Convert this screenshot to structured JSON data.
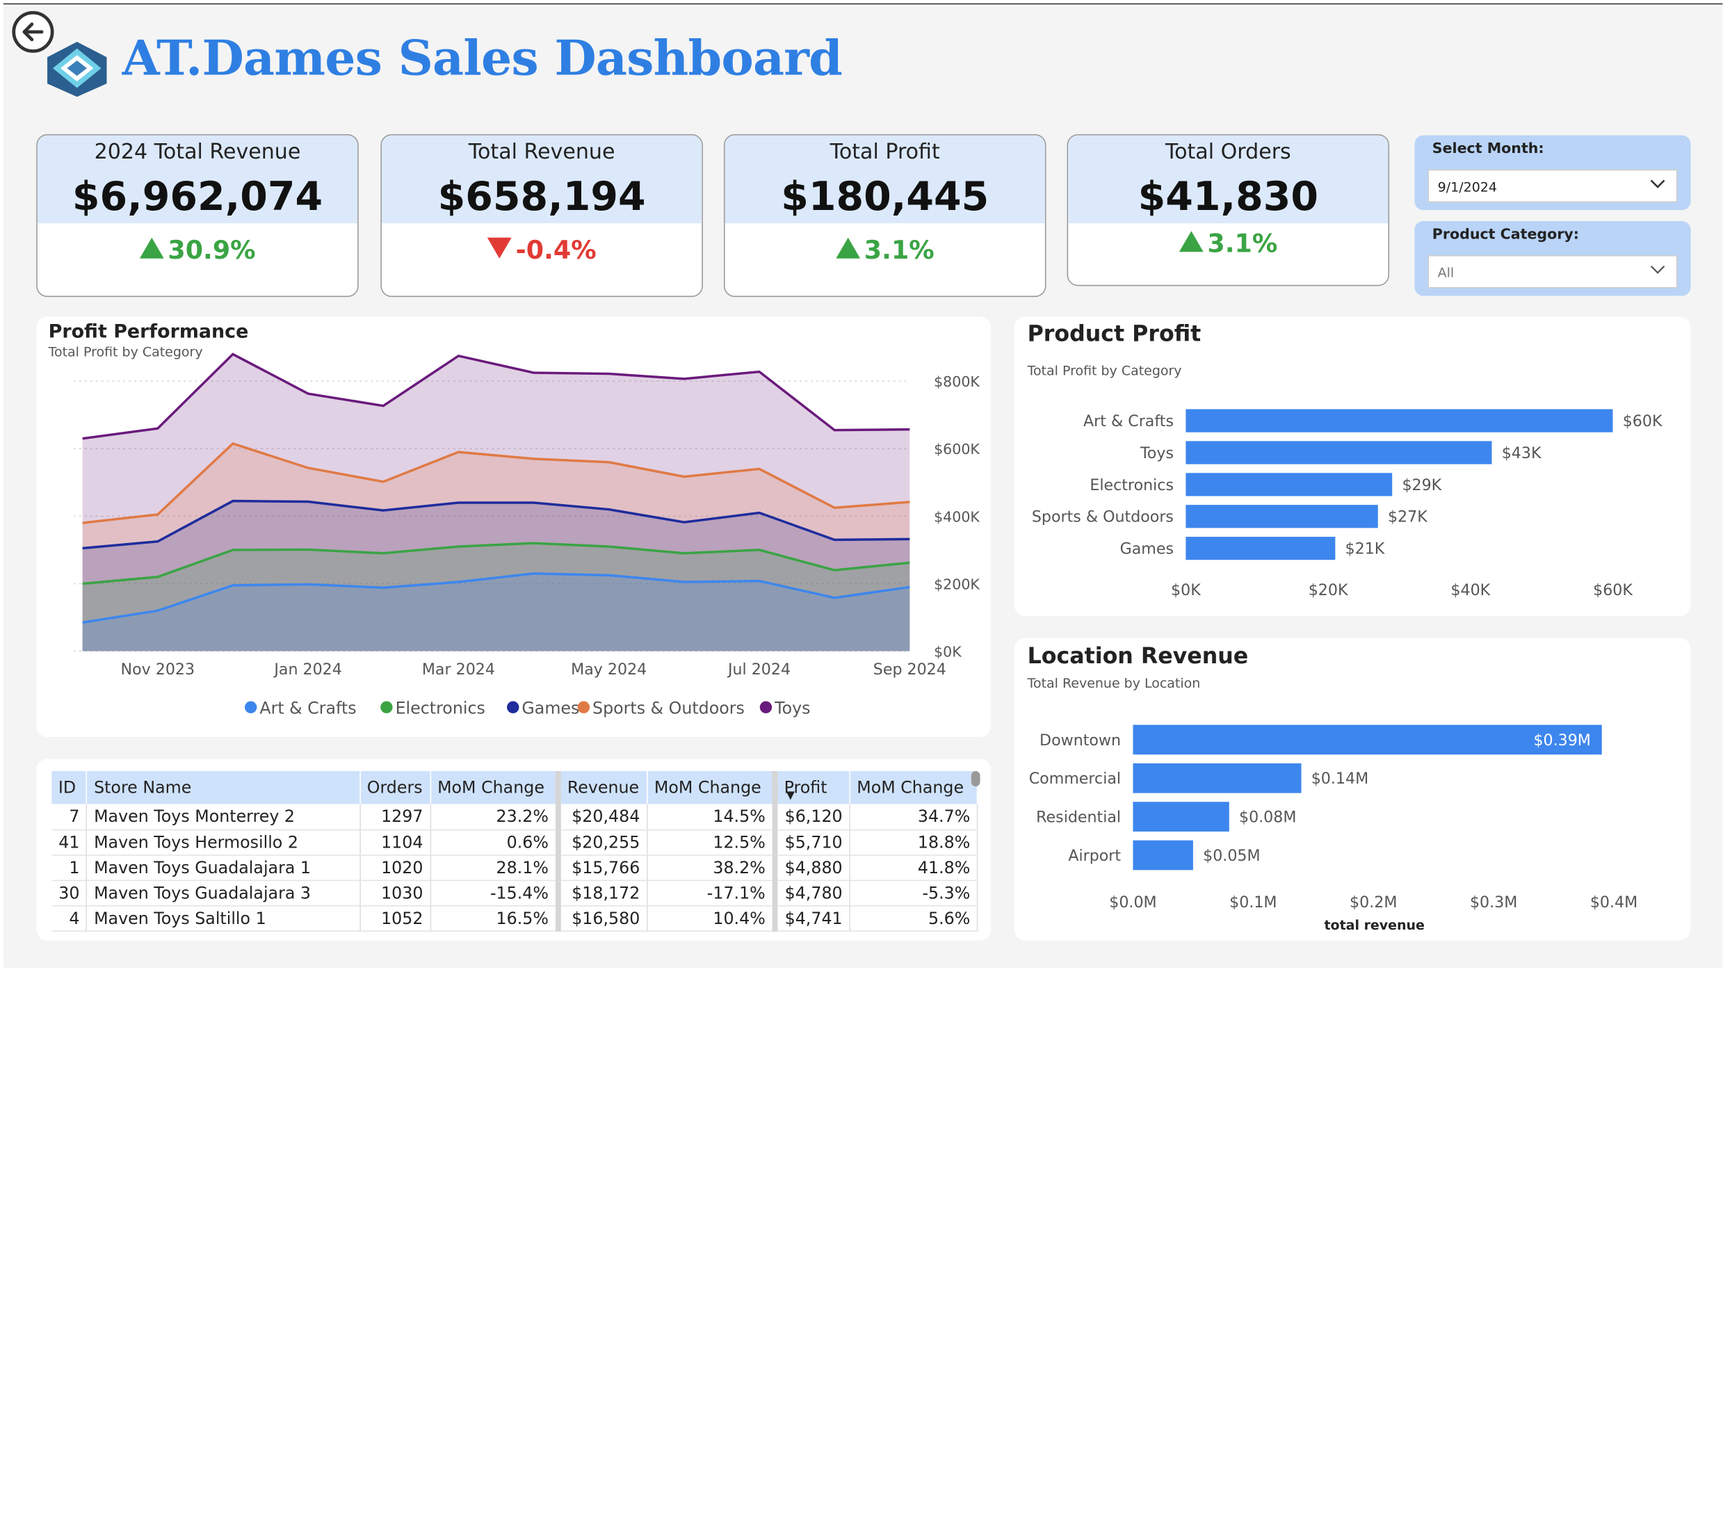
{
  "header": {
    "title": "AT.Dames Sales Dashboard"
  },
  "kpis": [
    {
      "label": "2024 Total Revenue",
      "value": "$6,962,074",
      "change": "30.9%",
      "direction": "up"
    },
    {
      "label": "Total Revenue",
      "value": "$658,194",
      "change": "-0.4%",
      "direction": "down"
    },
    {
      "label": "Total Profit",
      "value": "$180,445",
      "change": "3.1%",
      "direction": "up"
    },
    {
      "label": "Total Orders",
      "value": "$41,830",
      "change": "3.1%",
      "direction": "up"
    }
  ],
  "filters": {
    "month": {
      "label": "Select Month:",
      "value": "9/1/2024"
    },
    "category": {
      "label": "Product Category:",
      "value": "All"
    }
  },
  "colors": {
    "accent": "#2f7fe3",
    "positive": "#3aa444",
    "negative": "#e23a34",
    "bar": "#3d86ee"
  },
  "chart_data": [
    {
      "type": "area",
      "title": "Profit Performance",
      "subtitle": "Total Profit by Category",
      "stacked": true,
      "x": [
        "2023-10",
        "2023-11",
        "2023-12",
        "2024-01",
        "2024-02",
        "2024-03",
        "2024-04",
        "2024-05",
        "2024-06",
        "2024-07",
        "2024-08",
        "2024-09"
      ],
      "x_tick_labels": [
        "Nov 2023",
        "Jan 2024",
        "Mar 2024",
        "May 2024",
        "Jul 2024",
        "Sep 2024"
      ],
      "y_tick_labels": [
        "$0K",
        "$200K",
        "$400K",
        "$600K",
        "$800K"
      ],
      "ylim": [
        0,
        880000
      ],
      "grid": true,
      "legend_position": "bottom",
      "series": [
        {
          "name": "Art & Crafts",
          "color": "#3d86ee",
          "values": [
            85000,
            120000,
            195000,
            198000,
            188000,
            205000,
            230000,
            225000,
            205000,
            208000,
            158000,
            190000
          ]
        },
        {
          "name": "Electronics",
          "color": "#3aa444",
          "values": [
            115000,
            100000,
            105000,
            103000,
            102000,
            105000,
            90000,
            85000,
            85000,
            92000,
            82000,
            72000
          ]
        },
        {
          "name": "Games",
          "color": "#1e2c9c",
          "values": [
            105000,
            105000,
            145000,
            142000,
            127000,
            130000,
            120000,
            110000,
            92000,
            110000,
            90000,
            70000
          ]
        },
        {
          "name": "Sports & Outdoors",
          "color": "#e07a44",
          "values": [
            75000,
            80000,
            170000,
            100000,
            85000,
            150000,
            130000,
            140000,
            135000,
            130000,
            95000,
            110000
          ]
        },
        {
          "name": "Toys",
          "color": "#6a1a7c",
          "values": [
            250000,
            255000,
            265000,
            220000,
            225000,
            285000,
            255000,
            262000,
            290000,
            288000,
            230000,
            215000
          ]
        }
      ]
    },
    {
      "type": "bar",
      "orientation": "horizontal",
      "title": "Product Profit",
      "subtitle": "Total Profit by Category",
      "categories": [
        "Art & Crafts",
        "Toys",
        "Electronics",
        "Sports & Outdoors",
        "Games"
      ],
      "values": [
        60000,
        43000,
        29000,
        27000,
        21000
      ],
      "data_labels": [
        "$60K",
        "$43K",
        "$29K",
        "$27K",
        "$21K"
      ],
      "x_tick_labels": [
        "$0K",
        "$20K",
        "$40K",
        "$60K"
      ],
      "xlim": [
        0,
        66000
      ]
    },
    {
      "type": "bar",
      "orientation": "horizontal",
      "title": "Location Revenue",
      "subtitle": "Total Revenue by Location",
      "categories": [
        "Downtown",
        "Commercial",
        "Residential",
        "Airport"
      ],
      "values": [
        0.39,
        0.14,
        0.08,
        0.05
      ],
      "data_labels": [
        "$0.39M",
        "$0.14M",
        "$0.08M",
        "$0.05M"
      ],
      "x_tick_labels": [
        "$0.0M",
        "$0.1M",
        "$0.2M",
        "$0.3M",
        "$0.4M"
      ],
      "xlabel": "total revenue",
      "xlim": [
        0,
        0.42
      ]
    }
  ],
  "table": {
    "headers": [
      "ID",
      "Store Name",
      "Orders",
      "MoM Change",
      "Revenue",
      "MoM Change",
      "Profit",
      "MoM Change"
    ],
    "sort_indicator": "▼",
    "rows": [
      [
        "7",
        "Maven Toys Monterrey 2",
        "1297",
        "23.2%",
        "$20,484",
        "14.5%",
        "$6,120",
        "34.7%"
      ],
      [
        "41",
        "Maven Toys Hermosillo 2",
        "1104",
        "0.6%",
        "$20,255",
        "12.5%",
        "$5,710",
        "18.8%"
      ],
      [
        "1",
        "Maven Toys Guadalajara 1",
        "1020",
        "28.1%",
        "$15,766",
        "38.2%",
        "$4,880",
        "41.8%"
      ],
      [
        "30",
        "Maven Toys Guadalajara 3",
        "1030",
        "-15.4%",
        "$18,172",
        "-17.1%",
        "$4,780",
        "-5.3%"
      ],
      [
        "4",
        "Maven Toys Saltillo 1",
        "1052",
        "16.5%",
        "$16,580",
        "10.4%",
        "$4,741",
        "5.6%"
      ]
    ]
  }
}
